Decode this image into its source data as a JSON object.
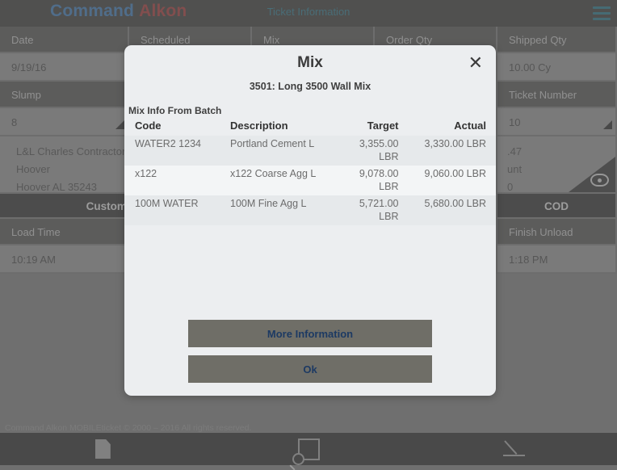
{
  "appbar": {
    "brand_primary": "Command",
    "brand_secondary": "Alkon",
    "title": "Ticket Information",
    "menu_icon": "hamburger-icon"
  },
  "ticket": {
    "headers_row1": [
      "Date",
      "Scheduled",
      "Mix",
      "Order Qty",
      "Shipped Qty"
    ],
    "values_row1": [
      "9/19/16",
      "",
      "",
      "",
      "10.00 Cy"
    ],
    "headers_row2": [
      "Slump",
      "",
      "",
      "",
      "Ticket Number"
    ],
    "values_row2": [
      "8",
      "",
      "",
      "",
      "10"
    ],
    "address_left": [
      "L&L Charles Contractor's",
      "Hoover",
      "Hoover AL 35243"
    ],
    "address_right": [
      ".47",
      "unt",
      "0"
    ],
    "band_left": "Customer Infor",
    "band_right": "COD",
    "headers_row3": [
      "Load Time",
      "Finish Unload"
    ],
    "values_row3": [
      "10:19 AM",
      "1:18 PM"
    ],
    "eye_icon": "eye-icon"
  },
  "footer": {
    "copyright": "Command Alkon MOBILEticket © 2000 – 2016 All rights reserved."
  },
  "bottomnav": {
    "items": [
      {
        "icon": "document-icon",
        "label": ""
      },
      {
        "icon": "review-square-magnifier-icon",
        "label": ""
      },
      {
        "icon": "pencil-signature-icon",
        "label": ""
      }
    ]
  },
  "modal": {
    "title": "Mix",
    "close_icon": "close-icon",
    "subtitle": "3501: Long 3500 Wall Mix",
    "section_label": "Mix Info From Batch",
    "columns": [
      "Code",
      "Description",
      "Target",
      "Actual"
    ],
    "rows": [
      {
        "code": "WATER2 1234",
        "description": "Portland Cement L",
        "target": "3,355.00 LBR",
        "actual": "3,330.00 LBR"
      },
      {
        "code": "x122",
        "description": "x122 Coarse Agg L",
        "target": "9,078.00 LBR",
        "actual": "9,060.00 LBR"
      },
      {
        "code": "100M WATER",
        "description": "100M Fine Agg L",
        "target": "5,721.00 LBR",
        "actual": "5,680.00 LBR"
      }
    ],
    "more_info_label": "More Information",
    "ok_label": "Ok"
  },
  "colors": {
    "brand_blue": "#2f6fb0",
    "brand_red": "#9e2b2b",
    "accent_teal": "#1f6f85",
    "modal_bg": "#eceef0",
    "button_bg": "#6f6e67",
    "button_text": "#1d3a63"
  }
}
